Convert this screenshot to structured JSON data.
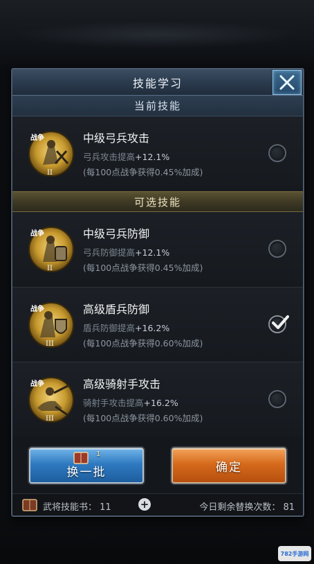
{
  "dialog": {
    "title": "技能学习",
    "close_icon": "close-x-icon"
  },
  "current_section": {
    "header": "当前技能",
    "skill": {
      "name": "中级弓兵攻击",
      "badge": "战争",
      "rank": "II",
      "effect_label": "弓兵攻击提高",
      "effect_value": "+12.1%",
      "bonus_note": "(每100点战争获得0.45%加成)",
      "selected": false
    }
  },
  "optional_section": {
    "header": "可选技能",
    "skills": [
      {
        "name": "中级弓兵防御",
        "badge": "战争",
        "rank": "II",
        "effect_label": "弓兵防御提高",
        "effect_value": "+12.1%",
        "bonus_note": "(每100点战争获得0.45%加成)",
        "selected": false
      },
      {
        "name": "高级盾兵防御",
        "badge": "战争",
        "rank": "III",
        "effect_label": "盾兵防御提高",
        "effect_value": "+16.2%",
        "bonus_note": "(每100点战争获得0.60%加成)",
        "selected": true
      },
      {
        "name": "高级骑射手攻击",
        "badge": "战争",
        "rank": "III",
        "effect_label": "骑射手攻击提高",
        "effect_value": "+16.2%",
        "bonus_note": "(每100点战争获得0.60%加成)",
        "selected": false
      }
    ]
  },
  "actions": {
    "refresh_label": "换一批",
    "refresh_cost": "1",
    "confirm_label": "确定"
  },
  "footer": {
    "books_label": "武将技能书：",
    "books_count": "11",
    "books_text": "武将技能书： 11",
    "remaining_label": "今日剩余替换次数：",
    "remaining_count": "81",
    "remaining_text": "今日剩余替换次数： 81"
  },
  "colors": {
    "panel_border": "#4b5a6c",
    "current_header": "#2e3f52",
    "optional_header": "#5a5233",
    "refresh_button": "#2f79c0",
    "confirm_button": "#d66a1c",
    "skill_icon_gold": "#c89a2e"
  }
}
